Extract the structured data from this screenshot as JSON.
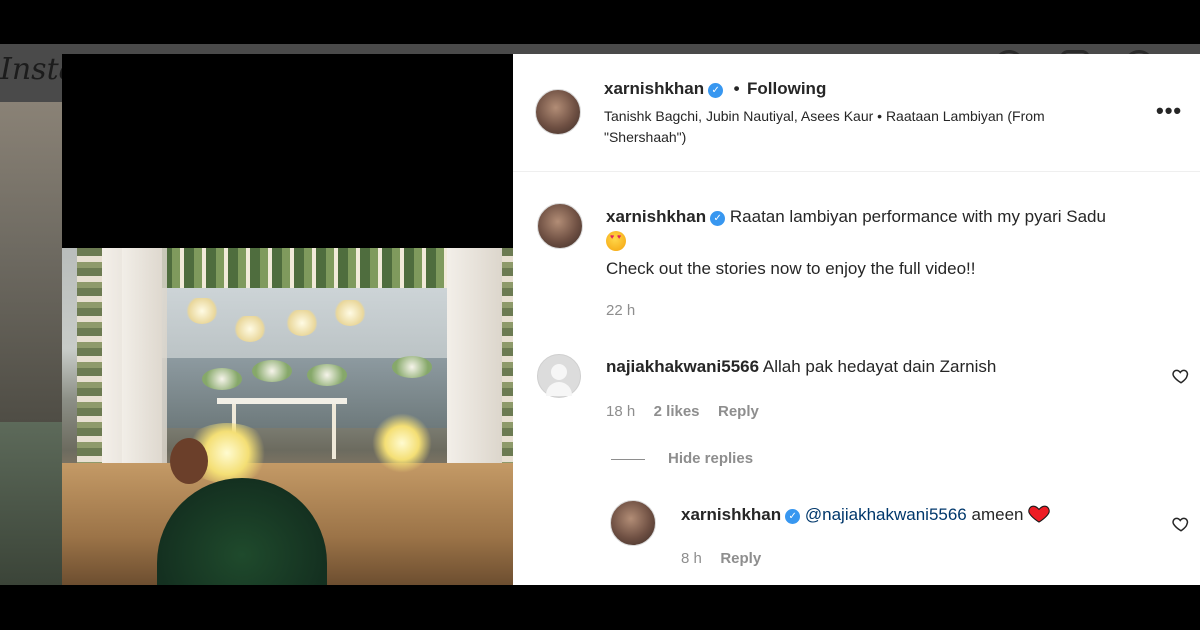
{
  "background": {
    "logo_text": "Instagram"
  },
  "post": {
    "author": "xarnishkhan",
    "follow_status": "Following",
    "separator": "•",
    "audio_line": "Tanishk Bagchi, Jubin Nautiyal, Asees Kaur • Raataan Lambiyan (From \"Shershaah\")",
    "more_label": "•••"
  },
  "caption": {
    "author": "xarnishkhan",
    "text_line1": "Raatan lambiyan performance with my pyari Sadu",
    "emoji": "smiling-face-with-hearts",
    "text_line2": "Check out the stories now to enjoy the full video!!",
    "time": "22 h"
  },
  "comments": [
    {
      "author": "najiakhakwani5566",
      "text": "Allah pak hedayat dain Zarnish",
      "time": "18 h",
      "likes": "2 likes",
      "reply_label": "Reply",
      "hide_replies_label": "Hide replies",
      "replies": [
        {
          "author": "xarnishkhan",
          "mention": "@najiakhakwani5566",
          "text": "ameen",
          "emoji": "red-heart",
          "time": "8 h",
          "reply_label": "Reply"
        }
      ]
    }
  ],
  "colors": {
    "verified_badge": "#3897f0",
    "text_primary": "#262626",
    "text_secondary": "#8e8e8e",
    "mention": "#00376b",
    "heart_red": "#ed1c24"
  }
}
